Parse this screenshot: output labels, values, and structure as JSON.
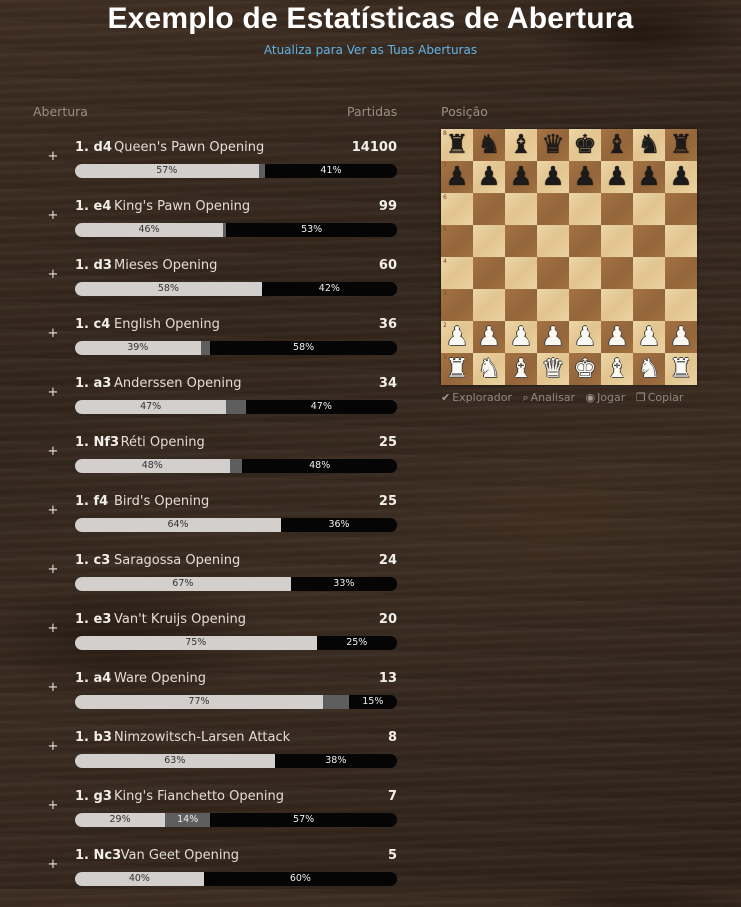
{
  "header": {
    "title": "Exemplo de Estatísticas de Abertura",
    "subtitle_link": "Atualiza para Ver as Tuas Aberturas"
  },
  "table": {
    "col_opening": "Abertura",
    "col_games": "Partidas",
    "expand_symbol": "+",
    "rows": [
      {
        "move": "1. d4",
        "name": "Queen's Pawn Opening",
        "games": "14100",
        "white": 57,
        "draw": 2,
        "black": 41,
        "white_label": "57%",
        "draw_label": "",
        "black_label": "41%"
      },
      {
        "move": "1. e4",
        "name": "King's Pawn Opening",
        "games": "99",
        "white": 46,
        "draw": 1,
        "black": 53,
        "white_label": "46%",
        "draw_label": "",
        "black_label": "53%"
      },
      {
        "move": "1. d3",
        "name": "Mieses Opening",
        "games": "60",
        "white": 58,
        "draw": 0,
        "black": 42,
        "white_label": "58%",
        "draw_label": "",
        "black_label": "42%"
      },
      {
        "move": "1. c4",
        "name": "English Opening",
        "games": "36",
        "white": 39,
        "draw": 3,
        "black": 58,
        "white_label": "39%",
        "draw_label": "",
        "black_label": "58%"
      },
      {
        "move": "1. a3",
        "name": "Anderssen Opening",
        "games": "34",
        "white": 47,
        "draw": 6,
        "black": 47,
        "white_label": "47%",
        "draw_label": "",
        "black_label": "47%"
      },
      {
        "move": "1. Nf3",
        "name": "Réti Opening",
        "games": "25",
        "white": 48,
        "draw": 4,
        "black": 48,
        "white_label": "48%",
        "draw_label": "",
        "black_label": "48%"
      },
      {
        "move": "1. f4",
        "name": "Bird's Opening",
        "games": "25",
        "white": 64,
        "draw": 0,
        "black": 36,
        "white_label": "64%",
        "draw_label": "",
        "black_label": "36%"
      },
      {
        "move": "1. c3",
        "name": "Saragossa Opening",
        "games": "24",
        "white": 67,
        "draw": 0,
        "black": 33,
        "white_label": "67%",
        "draw_label": "",
        "black_label": "33%"
      },
      {
        "move": "1. e3",
        "name": "Van't Kruijs Opening",
        "games": "20",
        "white": 75,
        "draw": 0,
        "black": 25,
        "white_label": "75%",
        "draw_label": "",
        "black_label": "25%"
      },
      {
        "move": "1. a4",
        "name": "Ware Opening",
        "games": "13",
        "white": 77,
        "draw": 8,
        "black": 15,
        "white_label": "77%",
        "draw_label": "",
        "black_label": "15%"
      },
      {
        "move": "1. b3",
        "name": "Nimzowitsch-Larsen Attack",
        "games": "8",
        "white": 62,
        "draw": 0,
        "black": 38,
        "white_label": "63%",
        "draw_label": "",
        "black_label": "38%"
      },
      {
        "move": "1. g3",
        "name": "King's Fianchetto Opening",
        "games": "7",
        "white": 28,
        "draw": 14,
        "black": 58,
        "white_label": "29%",
        "draw_label": "14%",
        "black_label": "57%"
      },
      {
        "move": "1. Nc3",
        "name": "Van Geet Opening",
        "games": "5",
        "white": 40,
        "draw": 0,
        "black": 60,
        "white_label": "40%",
        "draw_label": "",
        "black_label": "60%"
      }
    ]
  },
  "board": {
    "heading": "Posição",
    "rank_labels": [
      "8",
      "7",
      "6",
      "5",
      "4",
      "3",
      "2",
      "1"
    ],
    "position": [
      [
        "br",
        "bn",
        "bb",
        "bq",
        "bk",
        "bb",
        "bn",
        "br"
      ],
      [
        "bp",
        "bp",
        "bp",
        "bp",
        "bp",
        "bp",
        "bp",
        "bp"
      ],
      [
        "",
        "",
        "",
        "",
        "",
        "",
        "",
        ""
      ],
      [
        "",
        "",
        "",
        "",
        "",
        "",
        "",
        ""
      ],
      [
        "",
        "",
        "",
        "",
        "",
        "",
        "",
        ""
      ],
      [
        "",
        "",
        "",
        "",
        "",
        "",
        "",
        ""
      ],
      [
        "wp",
        "wp",
        "wp",
        "wp",
        "wp",
        "wp",
        "wp",
        "wp"
      ],
      [
        "wr",
        "wn",
        "wb",
        "wq",
        "wk",
        "wb",
        "wn",
        "wr"
      ]
    ],
    "tools": [
      {
        "label": "Explorador",
        "icon": "explorer-icon"
      },
      {
        "label": "Analisar",
        "icon": "analysis-icon"
      },
      {
        "label": "Jogar",
        "icon": "play-icon"
      },
      {
        "label": "Copiar",
        "icon": "copy-icon"
      }
    ]
  },
  "colors": {
    "link": "#5fb2e6",
    "win_white": "#d2cfcc",
    "draw": "#5f5e5e",
    "win_black": "#050505"
  }
}
